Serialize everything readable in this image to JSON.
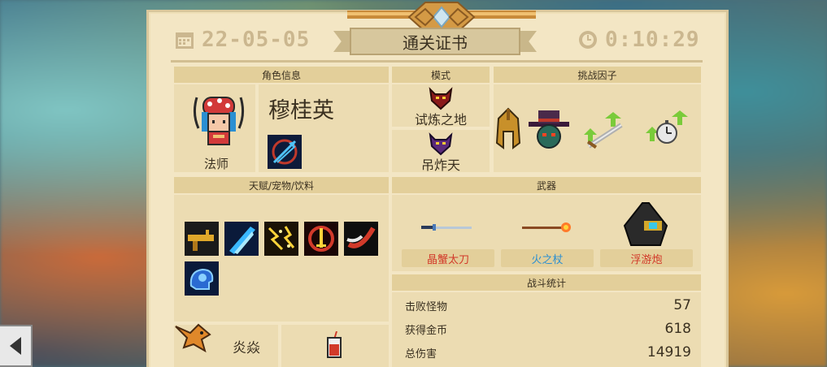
{
  "header": {
    "date": "22-05-05",
    "title": "通关证书",
    "time": "0:10:29"
  },
  "sections": {
    "character_info": "角色信息",
    "mode": "模式",
    "challenge_factors": "挑战因子",
    "talents_pets_drinks": "天赋/宠物/饮料",
    "weapons": "武器",
    "battle_stats": "战斗统计"
  },
  "character": {
    "name": "穆桂英",
    "class": "法师",
    "portrait_icon": "female-wizard-portrait-icon",
    "skill_icon": "arrow-burst-skill-icon"
  },
  "modes": [
    {
      "label": "试炼之地",
      "icon": "red-demon-mask-icon"
    },
    {
      "label": "吊炸天",
      "icon": "purple-demon-mask-icon"
    }
  ],
  "challenge_factors": [
    {
      "icon": "spartan-helmet-icon"
    },
    {
      "icon": "top-hat-goblin-icon"
    },
    {
      "icon": "sword-up-arrows-icon"
    },
    {
      "icon": "stopwatch-up-arrows-icon"
    }
  ],
  "talents": [
    {
      "icon": "golden-gun-icon"
    },
    {
      "icon": "blue-slash-icon"
    },
    {
      "icon": "lightning-sparks-icon"
    },
    {
      "icon": "red-ring-sword-icon"
    },
    {
      "icon": "red-claw-slash-icon"
    },
    {
      "icon": "blue-brain-icon"
    }
  ],
  "pet": {
    "name": "炎焱",
    "icon": "orange-bird-pet-icon"
  },
  "drink": {
    "icon": "red-soda-drink-icon"
  },
  "weapons": [
    {
      "name": "晶蟹太刀",
      "color": "#d23a2a",
      "icon": "crystal-crab-katana-icon"
    },
    {
      "name": "火之杖",
      "color": "#2a8fd2",
      "icon": "fire-staff-icon"
    },
    {
      "name": "浮游炮",
      "color": "#d23a2a",
      "icon": "floating-cannon-icon"
    }
  ],
  "stats": [
    {
      "label": "击败怪物",
      "value": "57"
    },
    {
      "label": "获得金币",
      "value": "618"
    },
    {
      "label": "总伤害",
      "value": "14919"
    }
  ],
  "colors": {
    "card_bg": "#f3e6c4",
    "header_bar": "#e3cf9a",
    "text": "#3a3020"
  }
}
